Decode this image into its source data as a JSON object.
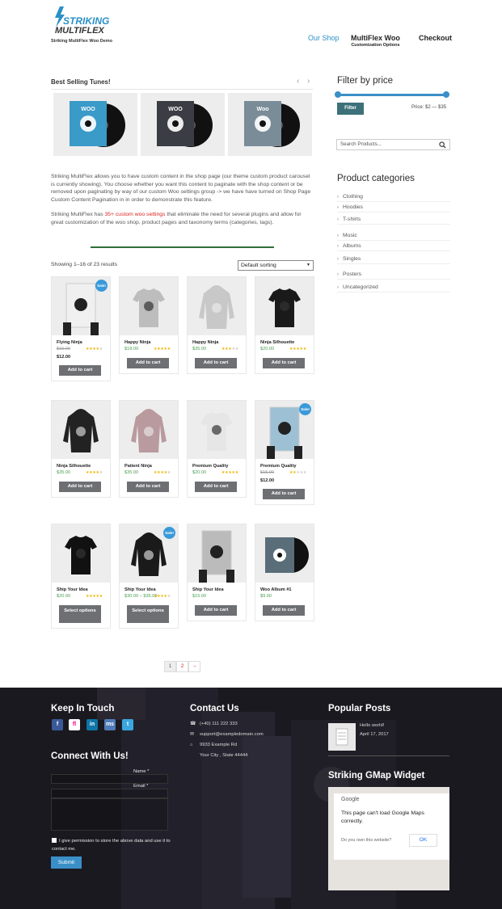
{
  "header": {
    "logo_line1": "STRIKING",
    "logo_line2": "MULTIFLEX",
    "tagline": "Striking MultiFlex Woo Demo",
    "nav": [
      {
        "label": "Our Shop",
        "sub": "",
        "active": true
      },
      {
        "label": "MultiFlex Woo",
        "sub": "Customization Options",
        "active": false
      },
      {
        "label": "Checkout",
        "sub": "",
        "active": false
      }
    ]
  },
  "carousel": {
    "title": "Best Selling Tunes!",
    "items": [
      {
        "name": "Woo Album blue",
        "color": "#3a9ac8",
        "text": "WOO"
      },
      {
        "name": "Woo Album dark",
        "color": "#3a3d44",
        "text": "WOO"
      },
      {
        "name": "Woo Album grey",
        "color": "#7a8c98",
        "text": "Woo"
      }
    ]
  },
  "intro": {
    "p1": "Striking MultiFlex allows you to have custom content in the shop page (our theme custom product carousel is currently showing). You choose whether you want this content to paginate with the shop content or be removed upon paginating by way of our custom Woo settings group -> we have have turned on Shop Page Custom Content Pagination in in order to demonstrate this feature.",
    "p2_a": "Striking MultiFlex has ",
    "p2_link": "35+ custom woo settings",
    "p2_b": " that eliminate the need for several plugins and allow for great customization of the woo shop, product pages and taxonomy terms (categories, tags)."
  },
  "shop": {
    "results": "Showing 1–16 of 23 results",
    "sort": "Default sorting",
    "pagination": [
      "1",
      "2",
      "→"
    ],
    "products": [
      {
        "name": "Flying Ninja",
        "old": "$15.00",
        "price": "$12.00",
        "rating": 4,
        "button": "Add to cart",
        "sale": "Sale!"
      },
      {
        "name": "Happy Ninja",
        "old": "",
        "price": "$18.00",
        "rating": 5,
        "button": "Add to cart",
        "sale": ""
      },
      {
        "name": "Happy Ninja",
        "old": "",
        "price": "$35.00",
        "rating": 3,
        "button": "Add to cart",
        "sale": ""
      },
      {
        "name": "Ninja Silhouette",
        "old": "",
        "price": "$20.00",
        "rating": 5,
        "button": "Add to cart",
        "sale": ""
      },
      {
        "name": "Ninja Silhouette",
        "old": "",
        "price": "$35.00",
        "rating": 4,
        "button": "Add to cart",
        "sale": ""
      },
      {
        "name": "Patient Ninja",
        "old": "",
        "price": "$35.00",
        "rating": 4,
        "button": "Add to cart",
        "sale": ""
      },
      {
        "name": "Premium Quality",
        "old": "",
        "price": "$20.00",
        "rating": 4.5,
        "button": "Add to cart",
        "sale": ""
      },
      {
        "name": "Premium Quality",
        "old": "$15.00",
        "price": "$12.00",
        "rating": 2,
        "button": "Add to cart",
        "sale": "Sale!"
      },
      {
        "name": "Ship Your Idea",
        "old": "",
        "price": "$20.00",
        "rating": 4.5,
        "button": "Select options",
        "sale": ""
      },
      {
        "name": "Ship Your Idea",
        "old": "",
        "price": "$30.00 – $35.00",
        "rating": 4,
        "button": "Select options",
        "sale": "Sale!"
      },
      {
        "name": "Ship Your Idea",
        "old": "",
        "price": "$15.00",
        "rating": 0,
        "button": "Add to cart",
        "sale": ""
      },
      {
        "name": "Woo Album #1",
        "old": "",
        "price": "$9.00",
        "rating": 0,
        "button": "Add to cart",
        "sale": ""
      }
    ]
  },
  "sidebar": {
    "filter_title": "Filter by price",
    "filter_button": "Filter",
    "price_range": "Price: $2 — $35",
    "search_placeholder": "Search Products...",
    "categories_title": "Product categories",
    "categories": [
      "Clothing",
      "Hoodies",
      "T-shirts",
      "Music",
      "Albums",
      "Singles",
      "Posters",
      "Uncategorized"
    ]
  },
  "footer": {
    "keep_title": "Keep In Touch",
    "social": [
      "f",
      "fl",
      "in",
      "ms",
      "t"
    ],
    "connect_title": "Connect With Us!",
    "name_label": "Name *",
    "email_label": "Email *",
    "consent": "I give permission to store the above data and use it to contact me.",
    "submit": "Submit",
    "contact_title": "Contact Us",
    "phone": "(+40) 111 222 333",
    "email": "support@exampledomain.com",
    "address1": "9933 Example Rd",
    "address2": "Your City , State  44444",
    "posts_title": "Popular Posts",
    "post_title": "Hello world!",
    "post_date": "April 17, 2017",
    "gmap_title": "Striking GMap Widget",
    "gmap_brand": "Google",
    "gmap_error": "This page can't load Google Maps correctly.",
    "gmap_question": "Do you own this website?",
    "gmap_ok": "OK"
  }
}
